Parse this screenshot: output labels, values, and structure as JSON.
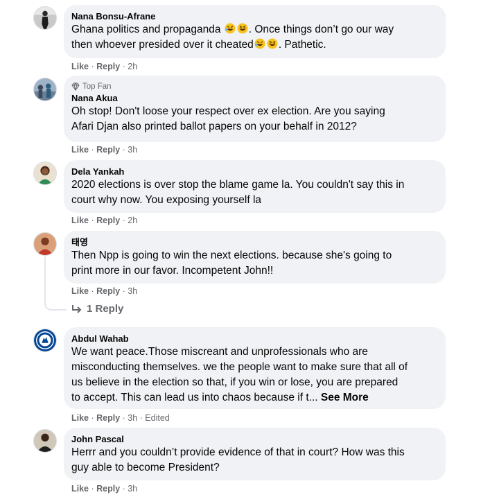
{
  "comments": [
    {
      "author": "Nana Bonsu-Afrane",
      "line1_a": "Ghana politics and propaganda",
      "line1_b": ". Once things don’t go our way",
      "line2_a": "then whoever presided over it cheated",
      "line2_b": ". Pathetic.",
      "like": "Like",
      "reply": "Reply",
      "time": "2h",
      "avatar_icon": "person-silhouette-avatar"
    },
    {
      "badge": "Top Fan",
      "author": "Nana Akua",
      "lines": [
        "Oh stop! Don't loose your respect over ex election. Are you saying",
        "Afari Djan also printed ballot papers on your behalf in 2012?"
      ],
      "like": "Like",
      "reply": "Reply",
      "time": "3h",
      "avatar_icon": "group-photo-avatar"
    },
    {
      "author": "Dela Yankah",
      "lines": [
        "2020 elections is over stop the blame game la. You couldn't say this in",
        "court why now. You exposing yourself la"
      ],
      "like": "Like",
      "reply": "Reply",
      "time": "2h",
      "avatar_icon": "woman-photo-avatar"
    },
    {
      "author": "태영",
      "lines": [
        "Then Npp is going to win the next elections. because she's going to",
        "print more in our favor. Incompetent John!!"
      ],
      "like": "Like",
      "reply": "Reply",
      "time": "3h",
      "avatar_icon": "person-photo-avatar",
      "replies_label": "1 Reply"
    },
    {
      "author": "Abdul Wahab",
      "lines": [
        "We want peace.Those miscreant and unprofessionals who are",
        "misconducting themselves. we the people want to make sure that all of",
        "us believe in the election so that, if you win or lose, you are prepared"
      ],
      "last_line": "to accept. This can lead us into chaos because if t...",
      "see_more": "See More",
      "like": "Like",
      "reply": "Reply",
      "time": "3h",
      "edited": "Edited",
      "avatar_icon": "chelsea-crest-avatar"
    },
    {
      "author": "John Pascal",
      "lines": [
        "Herrr and you couldn’t provide evidence of that in court? How was this",
        "guy able to become President?"
      ],
      "like": "Like",
      "reply": "Reply",
      "time": "3h",
      "avatar_icon": "man-photo-avatar"
    }
  ],
  "colors": {
    "bubble": "#f0f2f5",
    "meta": "#65676b",
    "text": "#050505",
    "chelsea_blue": "#034694"
  },
  "emoji_name": "rolling-on-floor-laughing-emoji"
}
